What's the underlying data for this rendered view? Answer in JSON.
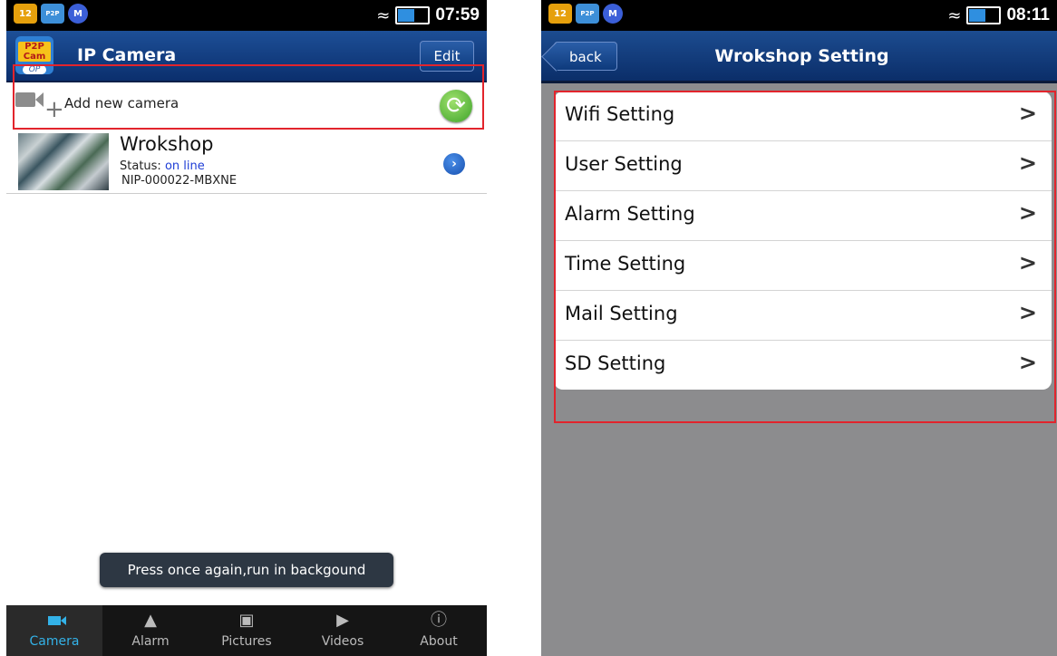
{
  "left_screen": {
    "statusbar": {
      "badge_count": "12",
      "time": "07:59"
    },
    "header": {
      "logo_line1": "P2P Cam",
      "logo_line2": "OP",
      "title": "IP Camera",
      "edit_label": "Edit"
    },
    "add_camera": {
      "label": "Add new camera"
    },
    "camera": {
      "name": "Wrokshop",
      "status_label": "Status:",
      "status_value": "on line",
      "id": "NIP-000022-MBXNE"
    },
    "toast": "Press once again,run in backgound",
    "tabs": [
      {
        "label": "Camera",
        "icon": "video-camera-icon",
        "active": true
      },
      {
        "label": "Alarm",
        "icon": "bell-icon",
        "active": false
      },
      {
        "label": "Pictures",
        "icon": "picture-icon",
        "active": false
      },
      {
        "label": "Videos",
        "icon": "video-play-icon",
        "active": false
      },
      {
        "label": "About",
        "icon": "info-icon",
        "active": false
      }
    ]
  },
  "right_screen": {
    "statusbar": {
      "badge_count": "12",
      "time": "08:11"
    },
    "header": {
      "back_label": "back",
      "title": "Wrokshop  Setting"
    },
    "settings": [
      {
        "label": "Wifi Setting"
      },
      {
        "label": "User Setting"
      },
      {
        "label": "Alarm Setting"
      },
      {
        "label": "Time Setting"
      },
      {
        "label": "Mail Setting"
      },
      {
        "label": "SD Setting"
      }
    ]
  },
  "colors": {
    "accent": "#33b2e8",
    "header": "#1d4f97",
    "highlight_box": "#e2242c",
    "online": "#1f3ed6"
  }
}
